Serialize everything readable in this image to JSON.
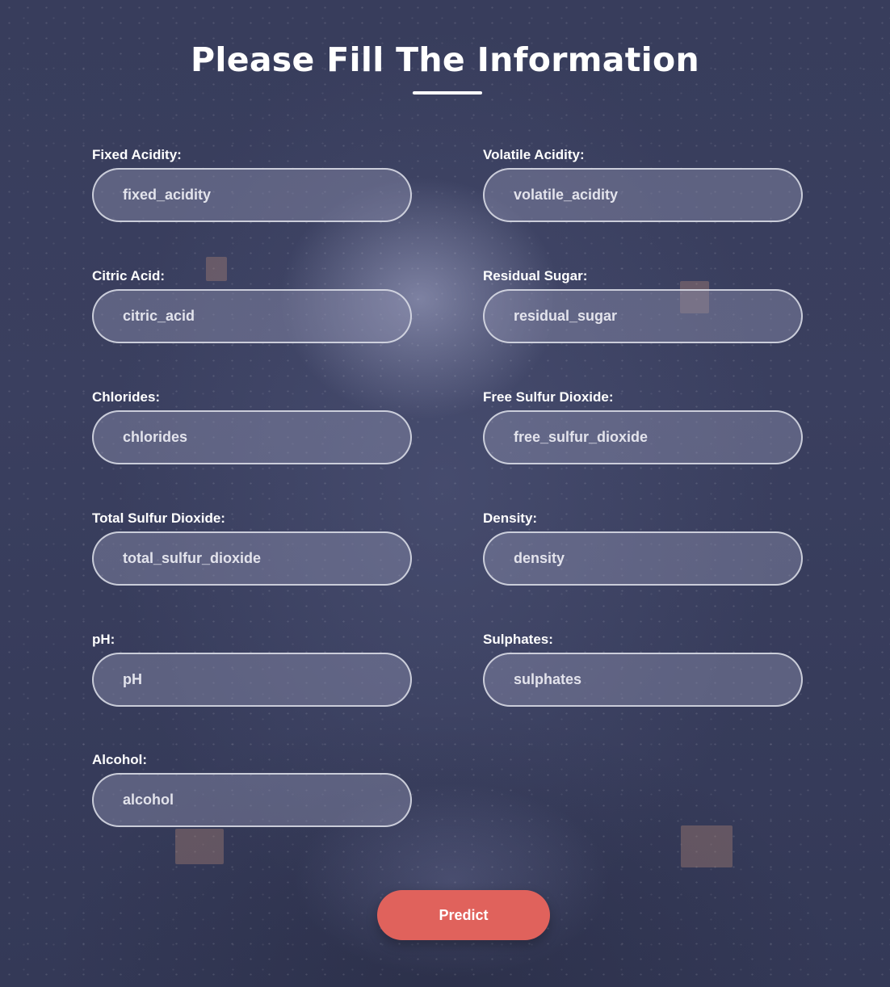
{
  "header": {
    "title": "Please Fill The Information"
  },
  "form": {
    "fields": [
      {
        "label": "Fixed Acidity:",
        "placeholder": "fixed_acidity"
      },
      {
        "label": "Volatile Acidity:",
        "placeholder": "volatile_acidity"
      },
      {
        "label": "Citric Acid:",
        "placeholder": "citric_acid"
      },
      {
        "label": "Residual Sugar:",
        "placeholder": "residual_sugar"
      },
      {
        "label": "Chlorides:",
        "placeholder": "chlorides"
      },
      {
        "label": "Free Sulfur Dioxide:",
        "placeholder": "free_sulfur_dioxide"
      },
      {
        "label": "Total Sulfur Dioxide:",
        "placeholder": "total_sulfur_dioxide"
      },
      {
        "label": "Density:",
        "placeholder": "density"
      },
      {
        "label": "pH:",
        "placeholder": "pH"
      },
      {
        "label": "Sulphates:",
        "placeholder": "sulphates"
      },
      {
        "label": "Alcohol:",
        "placeholder": "alcohol"
      }
    ],
    "submit_label": "Predict"
  },
  "colors": {
    "background": "#363b59",
    "button": "#e0625c",
    "text": "#ffffff"
  }
}
